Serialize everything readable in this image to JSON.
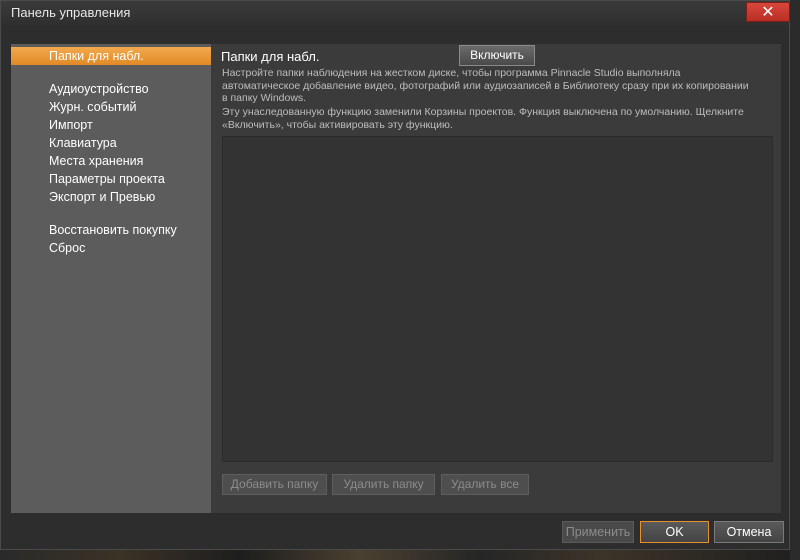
{
  "window": {
    "title": "Панель управления",
    "close_symbol": "✕"
  },
  "sidebar": {
    "items": [
      {
        "label": "Папки для набл.",
        "active": true
      },
      {
        "label": "Аудиоустройство"
      },
      {
        "label": "Журн. событий"
      },
      {
        "label": "Импорт"
      },
      {
        "label": "Клавиатура"
      },
      {
        "label": "Места хранения"
      },
      {
        "label": "Параметры проекта"
      },
      {
        "label": "Экспорт и Превью"
      },
      {
        "label": "Восстановить покупку"
      },
      {
        "label": "Сброс"
      }
    ]
  },
  "main": {
    "title": "Папки для набл.",
    "enable_label": "Включить",
    "desc1_line1": "Настройте папки наблюдения на жестком диске, чтобы программа Pinnacle Studio выполняла",
    "desc1_line2": "автоматическое добавление видео, фотографий или аудиозаписей в Библиотеку сразу при их копировании",
    "desc1_line3": "в папку Windows.",
    "desc2_line1": "Эту унаследованную функцию заменили Корзины проектов. Функция выключена по умолчанию. Щелкните",
    "desc2_line2": "«Включить», чтобы активировать эту функцию.",
    "add_folder_label": "Добавить папку",
    "remove_folder_label": "Удалить папку",
    "remove_all_label": "Удалить все"
  },
  "footer": {
    "apply_label": "Применить",
    "ok_label": "OK",
    "cancel_label": "Отмена"
  },
  "colors": {
    "accent": "#e8902c",
    "close": "#c9392f"
  }
}
